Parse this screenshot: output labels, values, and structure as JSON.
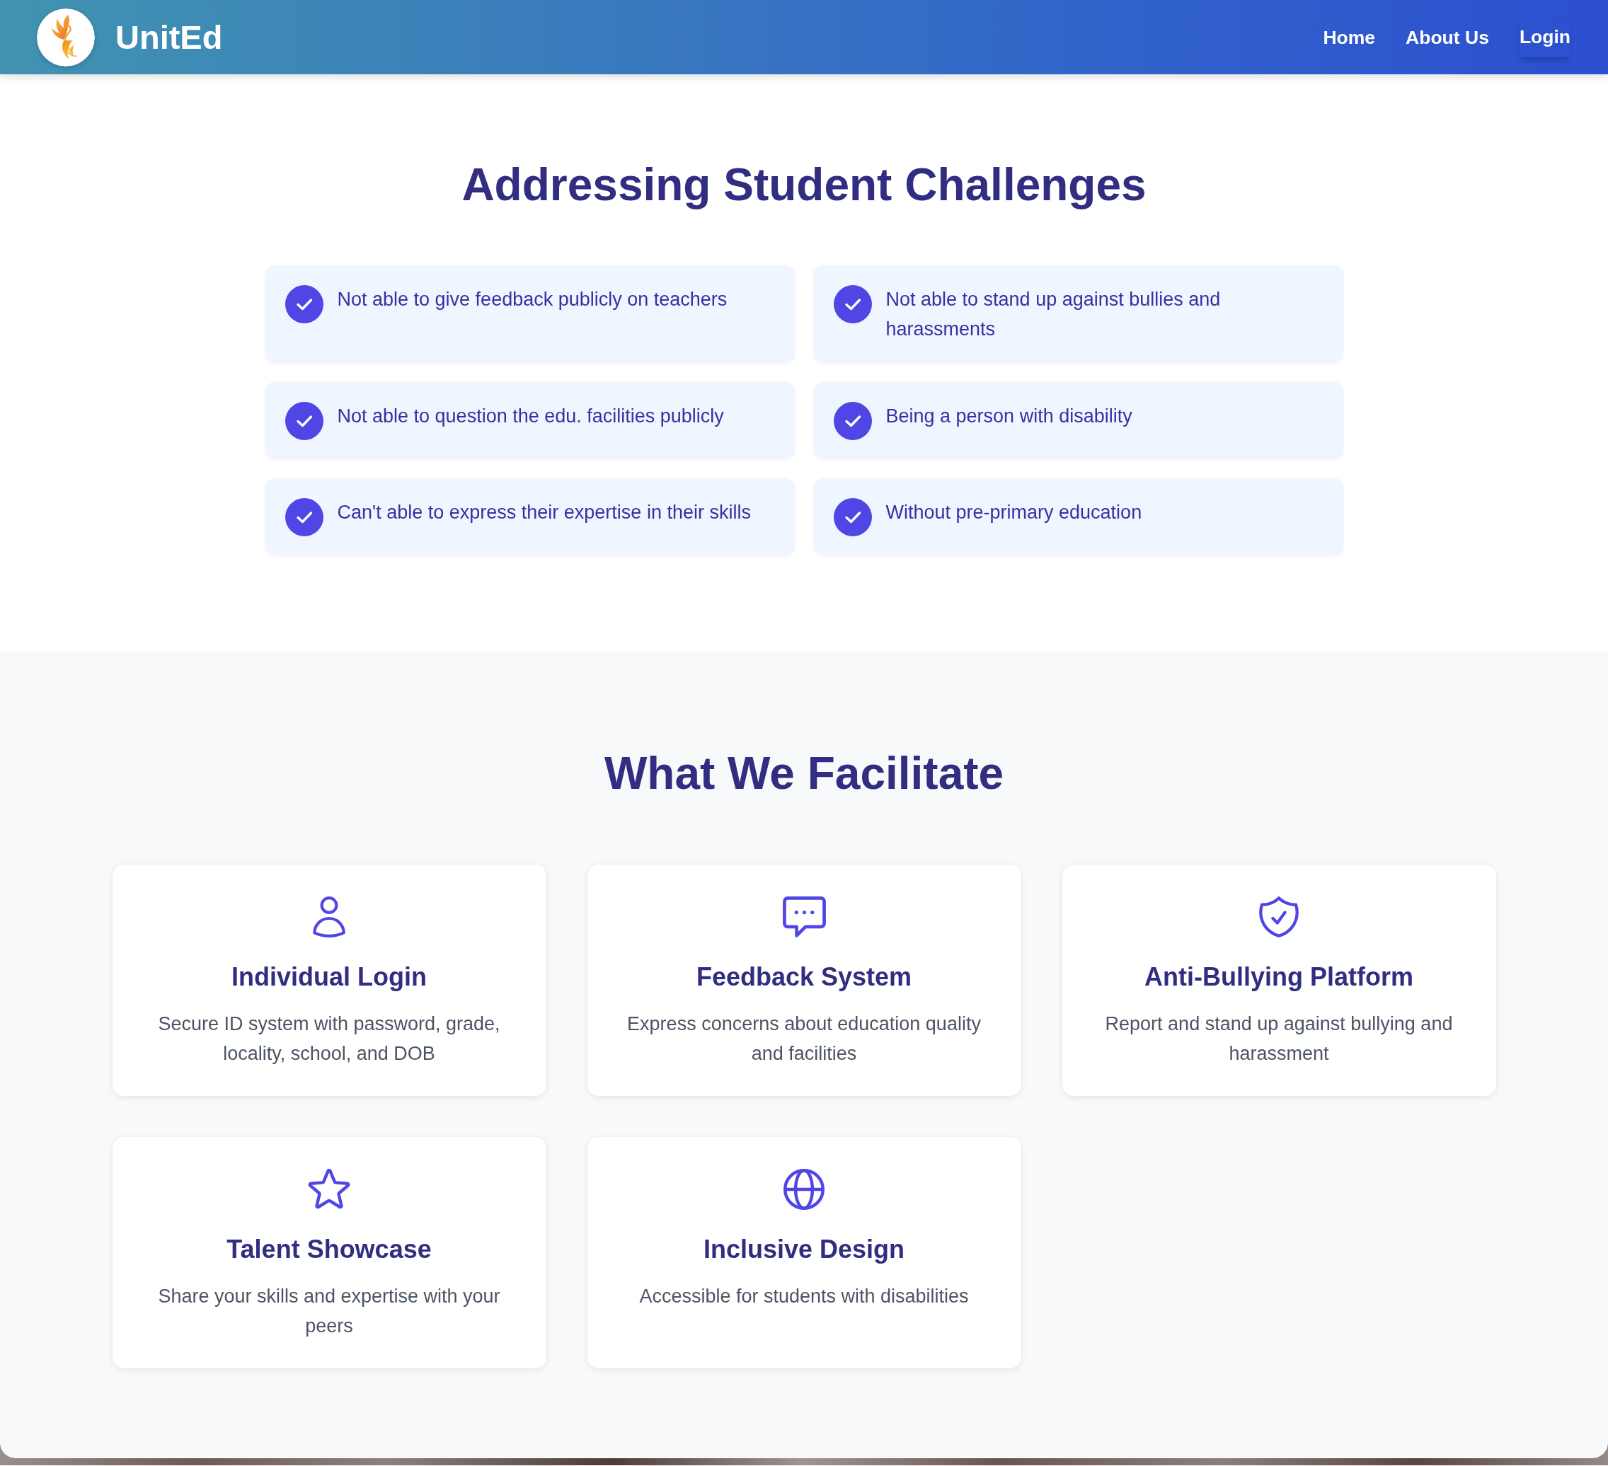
{
  "header": {
    "brand": "UnitEd",
    "nav": [
      {
        "label": "Home",
        "kind": "link"
      },
      {
        "label": "About Us",
        "kind": "link"
      },
      {
        "label": "Login",
        "kind": "button"
      }
    ]
  },
  "challenges": {
    "title": "Addressing Student Challenges",
    "items": [
      "Not able to give feedback publicly on teachers",
      "Not able to stand up against bullies and harassments",
      "Not able to question the edu. facilities publicly",
      "Being a person with disability",
      "Can't able to express their expertise in their skills",
      "Without pre-primary education"
    ]
  },
  "features": {
    "title": "What We Facilitate",
    "cards": [
      {
        "title": "Individual Login",
        "description": "Secure ID system with password, grade, locality, school, and DOB"
      },
      {
        "title": "Feedback System",
        "description": "Express concerns about education quality and facilities"
      },
      {
        "title": "Anti-Bullying Platform",
        "description": "Report and stand up against bullying and harassment"
      },
      {
        "title": "Talent Showcase",
        "description": "Share your skills and expertise with your peers"
      },
      {
        "title": "Inclusive Design",
        "description": "Accessible for students with disabilities"
      }
    ]
  }
}
